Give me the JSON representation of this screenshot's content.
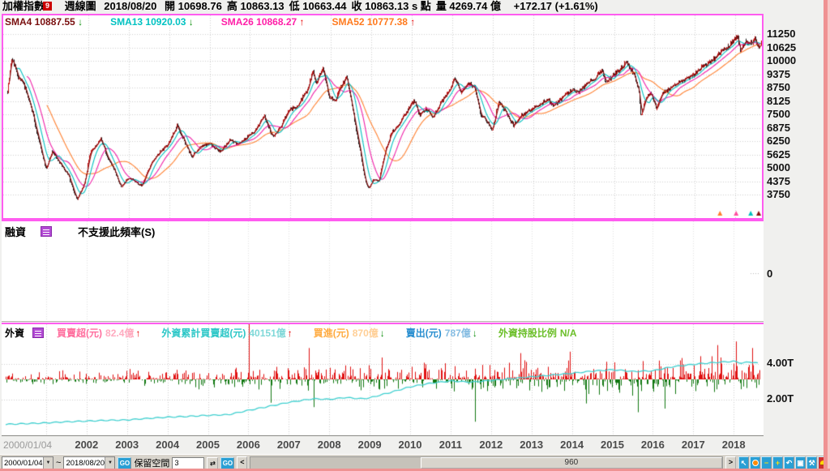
{
  "header": {
    "symbol": "加權指數",
    "badge": "9",
    "period": "週線圖",
    "date": "2018/08/20",
    "fields": [
      {
        "label": "開",
        "value": "10698.76"
      },
      {
        "label": "高",
        "value": "10863.13"
      },
      {
        "label": "低",
        "value": "10663.44"
      },
      {
        "label": "收",
        "value": "10863.13 s 點"
      },
      {
        "label": "量",
        "value": "4269.74 億"
      }
    ],
    "change": "+172.17 (+1.61%)"
  },
  "sma_legend": [
    {
      "label": "SMA4",
      "value": "10887.55",
      "dir": "down",
      "color": "#7a1010"
    },
    {
      "label": "SMA13",
      "value": "10920.03",
      "dir": "down",
      "color": "#00c2c2"
    },
    {
      "label": "SMA26",
      "value": "10868.27",
      "dir": "up",
      "color": "#ff1fa8"
    },
    {
      "label": "SMA52",
      "value": "10777.38",
      "dir": "up",
      "color": "#ff7a1e"
    }
  ],
  "main_axis_labels": [
    "11250",
    "10625",
    "10000",
    "9375",
    "8750",
    "8125",
    "7500",
    "6875",
    "6250",
    "5625",
    "5000",
    "4375",
    "3750"
  ],
  "middle_panel": {
    "title": "融資",
    "icon": "list-icon",
    "message": "不支援此頻率(S)",
    "axis_label": "0"
  },
  "foreign_panel": {
    "title": "外資",
    "icon": "list-icon",
    "series": [
      {
        "label": "買賣超(元)",
        "value": "82.4億",
        "dir": "up",
        "label_color": "#ff6e9e",
        "value_color": "#ffaabf",
        "arrow_color": "#e80000"
      },
      {
        "label": "外資累計買賣超(元)",
        "value": "40151億",
        "dir": "up",
        "label_color": "#2cc7c7",
        "value_color": "#7fd8d8",
        "arrow_color": "#e80000"
      },
      {
        "label": "買進(元)",
        "value": "870億",
        "dir": "down",
        "label_color": "#ffab40",
        "value_color": "#ffcf96",
        "arrow_color": "#0d8f0d"
      },
      {
        "label": "賣出(元)",
        "value": "787億",
        "dir": "down",
        "label_color": "#2a8fd0",
        "value_color": "#85bce2",
        "arrow_color": "#0d8f0d"
      },
      {
        "label": "外資持股比例",
        "value": "N/A",
        "dir": "none",
        "label_color": "#6cbf2a",
        "value_color": "#6cbf2a",
        "arrow_color": ""
      }
    ],
    "axis_labels": [
      "4.00T",
      "2.00T"
    ]
  },
  "x_axis": {
    "start": "2000/01/04",
    "years": [
      "2002",
      "2003",
      "2004",
      "2005",
      "2006",
      "2007",
      "2008",
      "2009",
      "2010",
      "2011",
      "2012",
      "2013",
      "2014",
      "2015",
      "2016",
      "2017",
      "2018"
    ]
  },
  "toolbar": {
    "from": "2000/01/04",
    "tilde": "~",
    "to": "2018/08/20",
    "go1": "GO",
    "reserve_label": "保留空間",
    "reserve_value": "3",
    "go2": "GO",
    "prev": "<",
    "scroll_value": "960",
    "next": ">",
    "icons": [
      {
        "name": "cursor-icon",
        "glyph": "↖",
        "bg": "#2a9fd4",
        "fg": "#ffffff"
      },
      {
        "name": "clock-icon",
        "glyph": "",
        "bg": "#2a9fd4",
        "fg": "#ff8a00"
      },
      {
        "name": "zoom-out-icon",
        "glyph": "−",
        "bg": "#2a9fd4",
        "fg": "#ffe000"
      },
      {
        "name": "zoom-in-icon",
        "glyph": "+",
        "bg": "#2a9fd4",
        "fg": "#ffe000"
      },
      {
        "name": "undo-icon",
        "glyph": "↶",
        "bg": "#2a9fd4",
        "fg": "#ffffff"
      },
      {
        "name": "fullscreen-icon",
        "glyph": "▣",
        "bg": "#2a9fd4",
        "fg": "#ffffff"
      },
      {
        "name": "tools-icon",
        "glyph": "⚒",
        "bg": "#2a9fd4",
        "fg": "#ffffff"
      },
      {
        "name": "alert-icon",
        "glyph": "",
        "bg": "#d03030",
        "fg": "#ffd800"
      }
    ]
  },
  "chart_data": [
    {
      "type": "candlestick",
      "title": "加權指數 週線圖 (TAIEX weekly)",
      "x_range": [
        2000.0,
        2018.65
      ],
      "y_ticks": [
        3750,
        4375,
        5000,
        5625,
        6250,
        6875,
        7500,
        8125,
        8750,
        9375,
        10000,
        10625,
        11250
      ],
      "ylim": [
        3600,
        11450
      ],
      "grid": true,
      "last_bar": {
        "date": "2018/08/20",
        "open": 10698.76,
        "high": 10863.13,
        "low": 10663.44,
        "close": 10863.13,
        "volume_billion": 4269.74
      },
      "sma_periods": [
        4,
        13,
        26,
        52
      ],
      "sma_colors": {
        "4": "#8a0f0f",
        "13": "#00c0c0",
        "26": "#f01fa8",
        "52": "#ff8030"
      },
      "keypoints": [
        [
          2000.0,
          8600
        ],
        [
          2000.1,
          10150
        ],
        [
          2000.25,
          9300
        ],
        [
          2000.4,
          8900
        ],
        [
          2000.6,
          7700
        ],
        [
          2000.8,
          6100
        ],
        [
          2000.95,
          4900
        ],
        [
          2001.1,
          5800
        ],
        [
          2001.3,
          5200
        ],
        [
          2001.5,
          4650
        ],
        [
          2001.72,
          3500
        ],
        [
          2001.9,
          4300
        ],
        [
          2002.05,
          5700
        ],
        [
          2002.3,
          6350
        ],
        [
          2002.5,
          5400
        ],
        [
          2002.65,
          4850
        ],
        [
          2002.8,
          4100
        ],
        [
          2003.0,
          4550
        ],
        [
          2003.15,
          4350
        ],
        [
          2003.32,
          4150
        ],
        [
          2003.55,
          5200
        ],
        [
          2003.75,
          5700
        ],
        [
          2003.95,
          6050
        ],
        [
          2004.2,
          7000
        ],
        [
          2004.4,
          6100
        ],
        [
          2004.55,
          5500
        ],
        [
          2004.75,
          5950
        ],
        [
          2005.0,
          6150
        ],
        [
          2005.25,
          5750
        ],
        [
          2005.5,
          6300
        ],
        [
          2005.7,
          6100
        ],
        [
          2005.9,
          6400
        ],
        [
          2006.1,
          6700
        ],
        [
          2006.35,
          7400
        ],
        [
          2006.55,
          6450
        ],
        [
          2006.75,
          6900
        ],
        [
          2006.95,
          7700
        ],
        [
          2007.15,
          7850
        ],
        [
          2007.4,
          8600
        ],
        [
          2007.55,
          9550
        ],
        [
          2007.62,
          8850
        ],
        [
          2007.8,
          9750
        ],
        [
          2007.95,
          8300
        ],
        [
          2008.1,
          8100
        ],
        [
          2008.25,
          8800
        ],
        [
          2008.38,
          9250
        ],
        [
          2008.55,
          7500
        ],
        [
          2008.7,
          6000
        ],
        [
          2008.85,
          4300
        ],
        [
          2008.92,
          4050
        ],
        [
          2009.05,
          4450
        ],
        [
          2009.18,
          4400
        ],
        [
          2009.35,
          5900
        ],
        [
          2009.5,
          6650
        ],
        [
          2009.7,
          7100
        ],
        [
          2009.9,
          7750
        ],
        [
          2010.05,
          8150
        ],
        [
          2010.18,
          7450
        ],
        [
          2010.35,
          7800
        ],
        [
          2010.5,
          7350
        ],
        [
          2010.7,
          8000
        ],
        [
          2010.9,
          8550
        ],
        [
          2011.05,
          9150
        ],
        [
          2011.2,
          8550
        ],
        [
          2011.4,
          9000
        ],
        [
          2011.55,
          8750
        ],
        [
          2011.7,
          7500
        ],
        [
          2011.85,
          7200
        ],
        [
          2011.97,
          6750
        ],
        [
          2012.15,
          8050
        ],
        [
          2012.35,
          7500
        ],
        [
          2012.5,
          6950
        ],
        [
          2012.7,
          7450
        ],
        [
          2012.9,
          7650
        ],
        [
          2013.1,
          7900
        ],
        [
          2013.35,
          8200
        ],
        [
          2013.5,
          7900
        ],
        [
          2013.7,
          8250
        ],
        [
          2013.95,
          8650
        ],
        [
          2014.1,
          8500
        ],
        [
          2014.3,
          8900
        ],
        [
          2014.55,
          9250
        ],
        [
          2014.7,
          9550
        ],
        [
          2014.8,
          8950
        ],
        [
          2014.95,
          9300
        ],
        [
          2015.1,
          9550
        ],
        [
          2015.3,
          9950
        ],
        [
          2015.5,
          9300
        ],
        [
          2015.62,
          8500
        ],
        [
          2015.66,
          7400
        ],
        [
          2015.78,
          8300
        ],
        [
          2015.9,
          8550
        ],
        [
          2016.04,
          7750
        ],
        [
          2016.2,
          8550
        ],
        [
          2016.4,
          8700
        ],
        [
          2016.6,
          9000
        ],
        [
          2016.8,
          9150
        ],
        [
          2017.0,
          9400
        ],
        [
          2017.2,
          9750
        ],
        [
          2017.45,
          10050
        ],
        [
          2017.65,
          10450
        ],
        [
          2017.85,
          10700
        ],
        [
          2018.04,
          11150
        ],
        [
          2018.12,
          10450
        ],
        [
          2018.25,
          10900
        ],
        [
          2018.4,
          10850
        ],
        [
          2018.48,
          11050
        ],
        [
          2018.56,
          10650
        ],
        [
          2018.63,
          10863
        ]
      ],
      "bottom_markers": [
        {
          "t": 2017.62,
          "color": "#ff8030"
        },
        {
          "t": 2018.02,
          "color": "#ff4fa0"
        },
        {
          "t": 2018.38,
          "color": "#00c0c0"
        },
        {
          "t": 2018.66,
          "color": "#8a0f0f"
        }
      ],
      "noise_seed": 7
    },
    {
      "type": "bar+line",
      "title": "外資買賣超(元) 與 外資累計買賣超(元)",
      "y_labels": [
        "4.00T",
        "2.00T"
      ],
      "bar_up_color": "#e01010",
      "bar_down_color": "#117711",
      "line_color": "#3fd0d0",
      "cumulative_T": [
        [
          2000.0,
          0.62
        ],
        [
          2000.5,
          0.66
        ],
        [
          2001.0,
          0.7
        ],
        [
          2001.5,
          0.76
        ],
        [
          2002.0,
          0.8
        ],
        [
          2002.5,
          0.84
        ],
        [
          2003.0,
          0.86
        ],
        [
          2003.5,
          0.95
        ],
        [
          2004.0,
          1.02
        ],
        [
          2004.5,
          1.06
        ],
        [
          2005.0,
          1.12
        ],
        [
          2005.5,
          1.16
        ],
        [
          2006.0,
          1.4
        ],
        [
          2006.5,
          1.62
        ],
        [
          2007.0,
          1.85
        ],
        [
          2007.3,
          1.95
        ],
        [
          2007.6,
          2.05
        ],
        [
          2008.0,
          2.02
        ],
        [
          2008.4,
          2.12
        ],
        [
          2008.8,
          2.05
        ],
        [
          2009.0,
          2.1
        ],
        [
          2009.5,
          2.4
        ],
        [
          2010.0,
          2.72
        ],
        [
          2010.5,
          2.92
        ],
        [
          2011.0,
          3.05
        ],
        [
          2011.5,
          2.98
        ],
        [
          2012.0,
          3.08
        ],
        [
          2012.5,
          3.18
        ],
        [
          2013.0,
          3.28
        ],
        [
          2013.5,
          3.38
        ],
        [
          2014.0,
          3.48
        ],
        [
          2014.5,
          3.6
        ],
        [
          2015.0,
          3.68
        ],
        [
          2015.5,
          3.58
        ],
        [
          2016.0,
          3.62
        ],
        [
          2016.5,
          3.85
        ],
        [
          2017.0,
          3.98
        ],
        [
          2017.5,
          4.08
        ],
        [
          2018.0,
          4.15
        ],
        [
          2018.2,
          4.05
        ],
        [
          2018.4,
          4.12
        ],
        [
          2018.63,
          4.03
        ]
      ],
      "spikes_billion": [
        [
          2006.02,
          900
        ],
        [
          2006.55,
          -320
        ],
        [
          2007.5,
          430
        ],
        [
          2007.62,
          -380
        ],
        [
          2009.3,
          300
        ],
        [
          2011.6,
          -580
        ],
        [
          2012.72,
          360
        ],
        [
          2013.95,
          380
        ],
        [
          2014.35,
          -330
        ],
        [
          2015.63,
          -450
        ],
        [
          2016.3,
          -400
        ],
        [
          2017.6,
          470
        ],
        [
          2018.05,
          520
        ],
        [
          2018.45,
          430
        ],
        [
          2018.63,
          85
        ]
      ],
      "noise_seed": 11
    }
  ]
}
